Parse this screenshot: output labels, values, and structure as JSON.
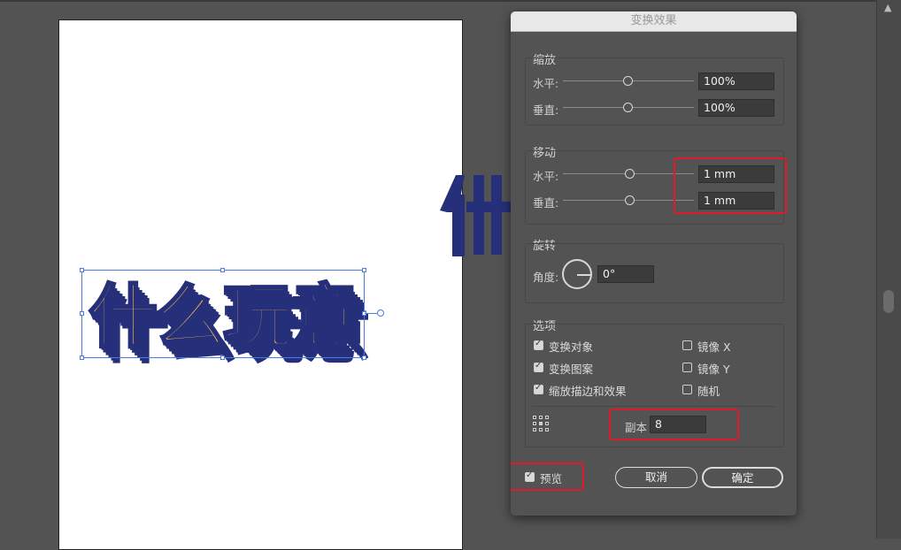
{
  "artwork": {
    "text": "什么玩意",
    "fragment_text": "什"
  },
  "dialog": {
    "title": "变换效果",
    "scale": {
      "label": "缩放",
      "horizontal": {
        "label": "水平:",
        "value": "100%",
        "knob": 0.5
      },
      "vertical": {
        "label": "垂直:",
        "value": "100%",
        "knob": 0.5
      }
    },
    "move": {
      "label": "移动",
      "horizontal": {
        "label": "水平:",
        "value": "1 mm",
        "knob": 0.5
      },
      "vertical": {
        "label": "垂直:",
        "value": "1 mm",
        "knob": 0.5
      }
    },
    "rotate": {
      "label": "旋转",
      "angle_label": "角度:",
      "angle_value": "0°"
    },
    "options": {
      "label": "选项",
      "transform_objects": {
        "label": "变换对象",
        "checked": true
      },
      "transform_patterns": {
        "label": "变换图案",
        "checked": true
      },
      "scale_strokes": {
        "label": "缩放描边和效果",
        "checked": true
      },
      "reflect_x": {
        "label": "镜像 X",
        "checked": false
      },
      "reflect_y": {
        "label": "镜像 Y",
        "checked": false
      },
      "random": {
        "label": "随机",
        "checked": false
      }
    },
    "copies": {
      "label": "副本",
      "value": "8"
    },
    "preview": {
      "label": "预览",
      "checked": true
    },
    "cancel_label": "取消",
    "ok_label": "确定"
  },
  "colors": {
    "highlight": "#e01a2a",
    "text_face": "#f2b653",
    "text_shadow": "#26307a",
    "selection": "#4a7be6"
  }
}
